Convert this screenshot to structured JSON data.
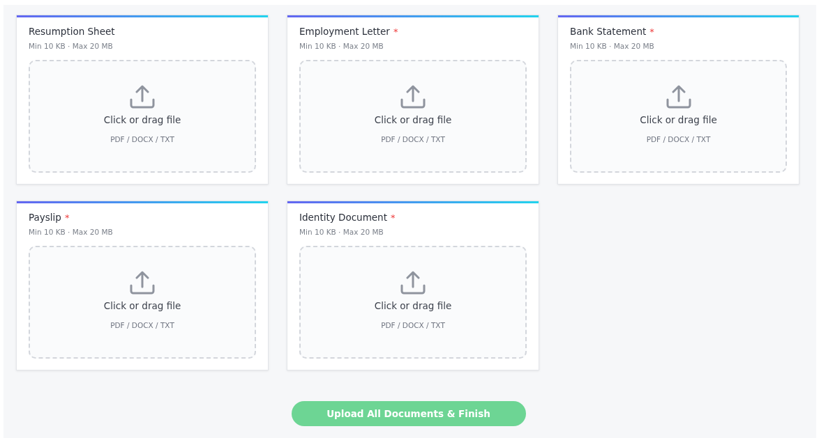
{
  "required_mark": "*",
  "uploads": [
    {
      "title": "Resumption Sheet",
      "required": false,
      "limits": "Min 10 KB · Max 20 MB",
      "prompt": "Click or drag file",
      "formats": "PDF / DOCX / TXT"
    },
    {
      "title": "Employment Letter",
      "required": true,
      "limits": "Min 10 KB · Max 20 MB",
      "prompt": "Click or drag file",
      "formats": "PDF / DOCX / TXT"
    },
    {
      "title": "Bank Statement",
      "required": true,
      "limits": "Min 10 KB · Max 20 MB",
      "prompt": "Click or drag file",
      "formats": "PDF / DOCX / TXT"
    },
    {
      "title": "Payslip",
      "required": true,
      "limits": "Min 10 KB · Max 20 MB",
      "prompt": "Click or drag file",
      "formats": "PDF / DOCX / TXT"
    },
    {
      "title": "Identity Document",
      "required": true,
      "limits": "Min 10 KB · Max 20 MB",
      "prompt": "Click or drag file",
      "formats": "PDF / DOCX / TXT"
    }
  ],
  "submit_button": "Upload All Documents & Finish"
}
